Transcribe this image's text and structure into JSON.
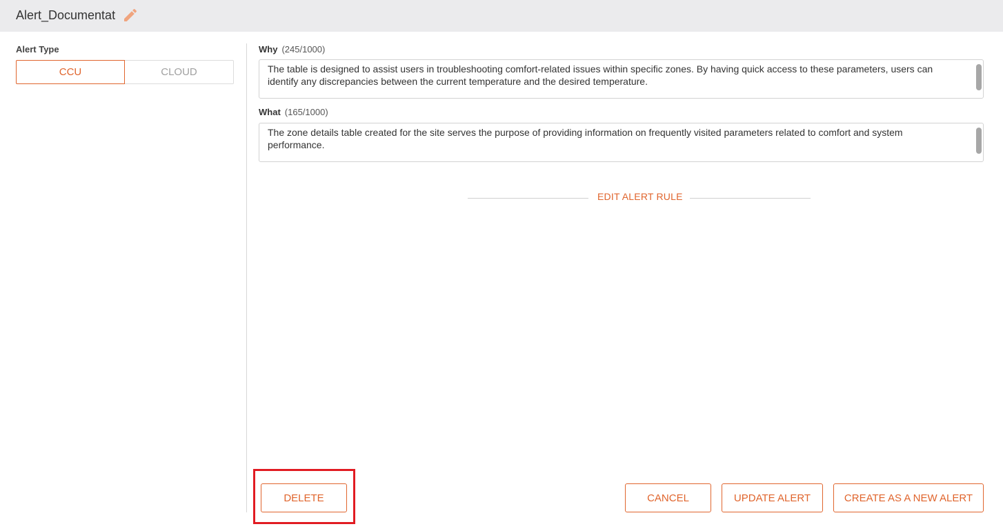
{
  "header": {
    "title": "Alert_Documentat",
    "edit_icon": "pencil-icon"
  },
  "alert_type": {
    "label": "Alert Type",
    "options": [
      "CCU",
      "CLOUD"
    ],
    "selected": "CCU"
  },
  "why": {
    "label": "Why",
    "count": "(245/1000)",
    "value": "The table is designed to assist users in troubleshooting comfort-related issues within specific zones. By having quick access to these parameters, users can identify any discrepancies between the current temperature and the desired temperature."
  },
  "what": {
    "label": "What",
    "count": "(165/1000)",
    "value": "The zone details table created for the site serves the purpose of providing information on frequently visited parameters related to comfort and system performance."
  },
  "rule": {
    "label": "EDIT ALERT RULE"
  },
  "buttons": {
    "delete": "DELETE",
    "cancel": "CANCEL",
    "update": "UPDATE ALERT",
    "create_new": "CREATE AS A NEW ALERT"
  },
  "colors": {
    "accent": "#e0642c",
    "highlight": "#e11b22",
    "header_bg": "#ebebed"
  }
}
